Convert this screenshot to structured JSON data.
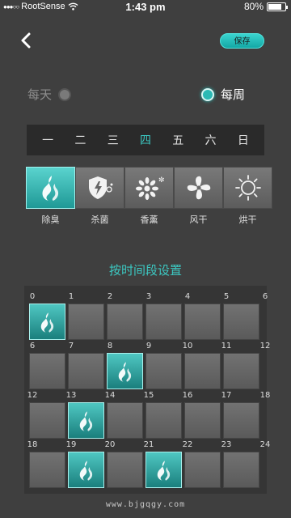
{
  "status_bar": {
    "carrier": "RootSense",
    "signal_dots": "●●●○○",
    "time": "1:43 pm",
    "battery": "80%",
    "battery_level": 0.8
  },
  "header": {
    "save_label": "保存"
  },
  "frequency": {
    "daily_label": "每天",
    "weekly_label": "每周",
    "selected": "weekly"
  },
  "weekdays": {
    "items": [
      "一",
      "二",
      "三",
      "四",
      "五",
      "六",
      "日"
    ],
    "active_index": 3
  },
  "modes": {
    "items": [
      {
        "label": "除臭",
        "icon": "flame-icon",
        "active": true
      },
      {
        "label": "杀菌",
        "icon": "shield-icon",
        "active": false
      },
      {
        "label": "香薰",
        "icon": "flower-icon",
        "active": false
      },
      {
        "label": "风干",
        "icon": "fan-icon",
        "active": false
      },
      {
        "label": "烘干",
        "icon": "sun-icon",
        "active": false
      }
    ]
  },
  "schedule": {
    "title": "按时间段设置",
    "rows": [
      {
        "ticks": [
          "0",
          "1",
          "2",
          "3",
          "4",
          "5",
          "6"
        ],
        "on": [
          0
        ]
      },
      {
        "ticks": [
          "6",
          "7",
          "8",
          "9",
          "10",
          "11",
          "12"
        ],
        "on": [
          2
        ]
      },
      {
        "ticks": [
          "12",
          "13",
          "14",
          "15",
          "16",
          "17",
          "18"
        ],
        "on": [
          1
        ]
      },
      {
        "ticks": [
          "18",
          "19",
          "20",
          "21",
          "22",
          "23",
          "24"
        ],
        "on": [
          1,
          3
        ]
      }
    ]
  },
  "watermark": "www.bjgqgy.com",
  "colors": {
    "accent": "#3cc8c2",
    "background": "#3f3f3f",
    "tile": "#6a6a6a"
  }
}
